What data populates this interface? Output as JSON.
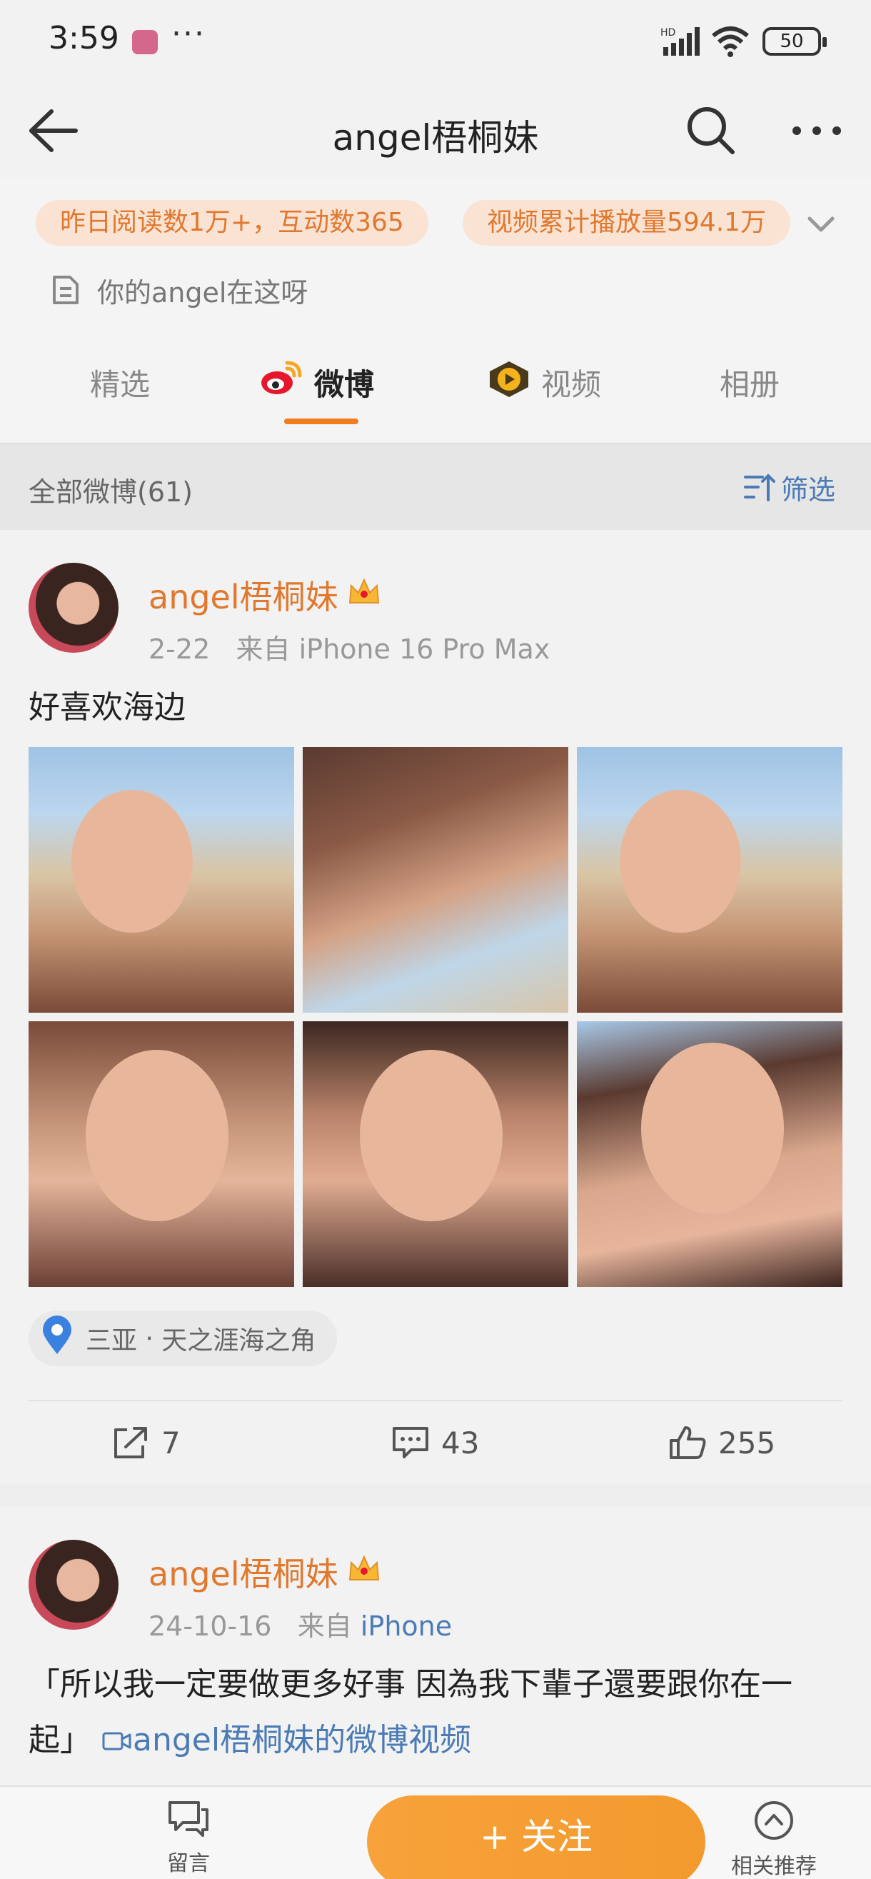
{
  "status": {
    "time": "3:59",
    "dots": "···",
    "battery": "50",
    "signal_label": "HD"
  },
  "header": {
    "title": "angel梧桐妹"
  },
  "profile": {
    "stat_reads": "昨日阅读数1万+，互动数365",
    "stat_video": "视频累计播放量594.1万",
    "bio": "你的angel在这呀"
  },
  "tabs": [
    {
      "label": "精选"
    },
    {
      "label": "微博"
    },
    {
      "label": "视频"
    },
    {
      "label": "相册"
    }
  ],
  "filter": {
    "count_label": "全部微博(61)",
    "filter_label": "筛选"
  },
  "posts": [
    {
      "author": "angel梧桐妹",
      "date": "2-22",
      "source_prefix": "来自",
      "source": "iPhone 16 Pro Max",
      "text": "好喜欢海边",
      "location_city": "三亚",
      "location_sep": "·",
      "location_place": "天之涯海之角",
      "reposts": "7",
      "comments": "43",
      "likes": "255"
    },
    {
      "author": "angel梧桐妹",
      "date": "24-10-16",
      "source_prefix": "来自",
      "source": "iPhone",
      "text": "「所以我一定要做更多好事 因為我下輩子還要跟你在一起」",
      "video_link": "angel梧桐妹的微博视频"
    }
  ],
  "bottom_bar": {
    "comment_label": "留言",
    "follow_label": "+ 关注",
    "related_label": "相关推荐"
  },
  "colors": {
    "accent_orange": "#e0782e",
    "link_blue": "#4b7bb5",
    "follow_button": "#f29a2e"
  }
}
